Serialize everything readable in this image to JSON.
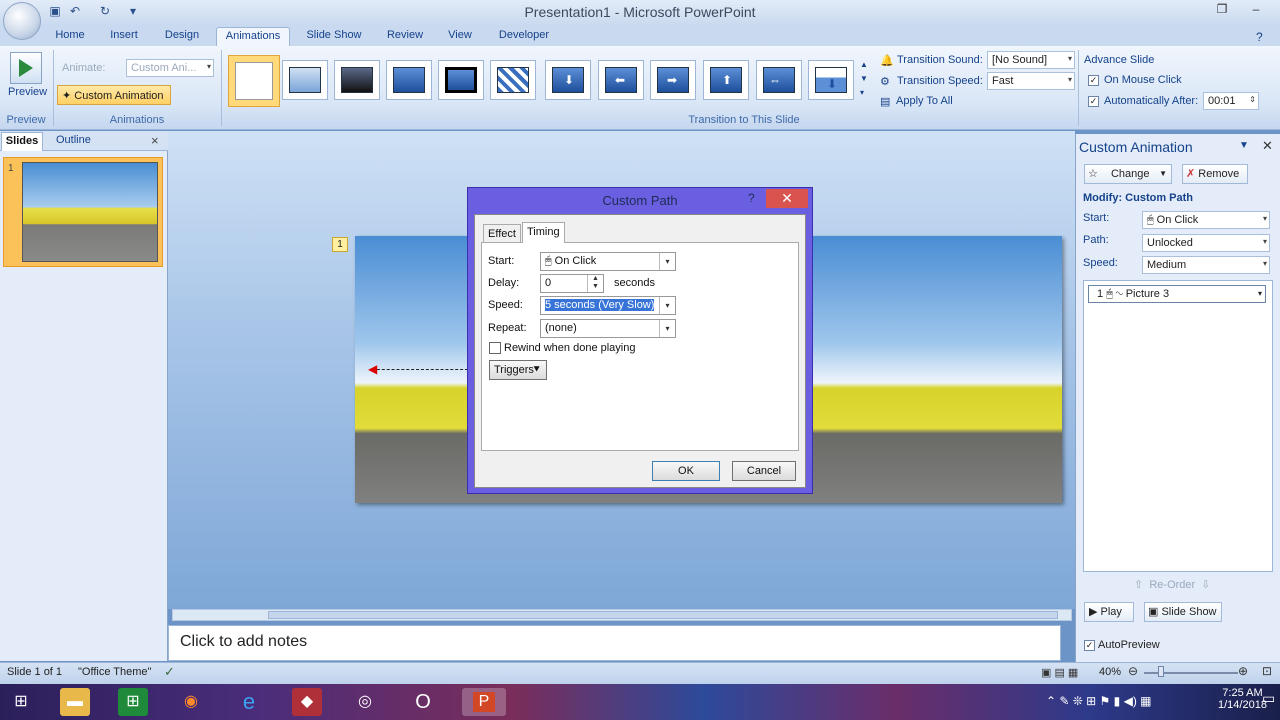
{
  "window": {
    "title": "Presentation1 - Microsoft PowerPoint"
  },
  "ribbon_tabs": [
    "Home",
    "Insert",
    "Design",
    "Animations",
    "Slide Show",
    "Review",
    "View",
    "Developer"
  ],
  "ribbon": {
    "preview_label": "Preview",
    "preview_group": "Preview",
    "animate_label": "Animate:",
    "animate_value": "Custom Ani...",
    "custom_animation_label": "Custom Animation",
    "animations_group": "Animations",
    "transition_group": "Transition to This Slide",
    "transition_sound_label": "Transition Sound:",
    "transition_sound_value": "[No Sound]",
    "transition_speed_label": "Transition Speed:",
    "transition_speed_value": "Fast",
    "apply_all_label": "Apply To All",
    "advance_slide_label": "Advance Slide",
    "on_mouse_click_label": "On Mouse Click",
    "auto_after_label": "Automatically After:",
    "auto_after_value": "00:01"
  },
  "left_panel": {
    "tab_slides": "Slides",
    "tab_outline": "Outline",
    "close": "×",
    "slide_number": "1"
  },
  "slide": {
    "badge": "1"
  },
  "notes": {
    "placeholder": "Click to add notes"
  },
  "status": {
    "slide_info": "Slide 1 of 1",
    "theme": "\"Office Theme\"",
    "zoom": "40%"
  },
  "custom_animation_pane": {
    "title": "Custom Animation",
    "change_label": "Change",
    "remove_label": "Remove",
    "modify_label": "Modify: Custom Path",
    "start_label": "Start:",
    "start_value": "On Click",
    "path_label": "Path:",
    "path_value": "Unlocked",
    "speed_label": "Speed:",
    "speed_value": "Medium",
    "item_number": "1",
    "item_label": "Picture 3",
    "reorder_label": "Re-Order",
    "play_label": "Play",
    "slideshow_label": "Slide Show",
    "autopreview_label": "AutoPreview"
  },
  "dialog": {
    "title": "Custom Path",
    "help": "?",
    "close": "✕",
    "tab_effect": "Effect",
    "tab_timing": "Timing",
    "start_label": "Start:",
    "start_value": "On Click",
    "delay_label": "Delay:",
    "delay_value": "0",
    "seconds_label": "seconds",
    "speed_label": "Speed:",
    "speed_value": "5 seconds (Very Slow)",
    "repeat_label": "Repeat:",
    "repeat_value": "(none)",
    "rewind_label": "Rewind when done playing",
    "triggers_label": "Triggers",
    "ok_label": "OK",
    "cancel_label": "Cancel"
  },
  "taskbar": {
    "time": "7:25 AM",
    "date": "1/14/2018"
  }
}
